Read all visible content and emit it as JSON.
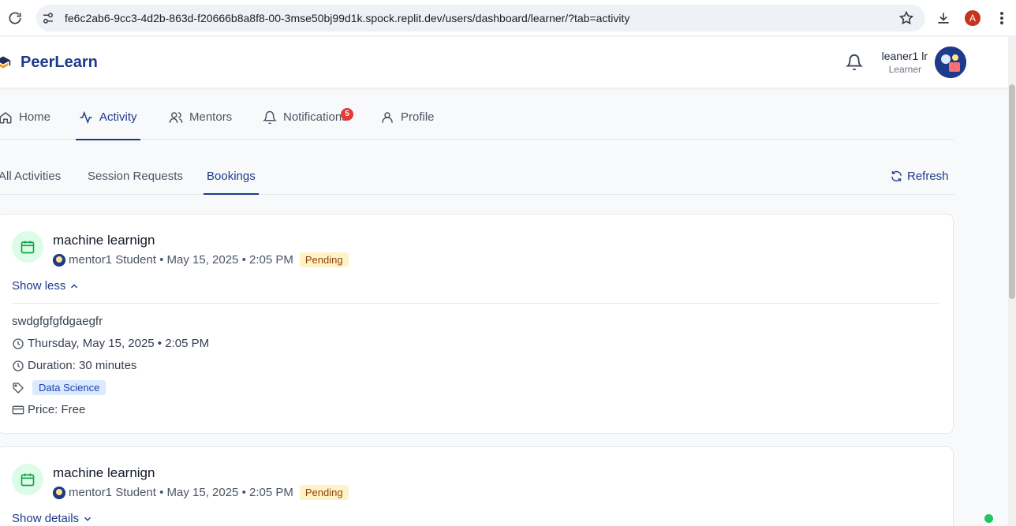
{
  "browser": {
    "url": "fe6c2ab6-9cc3-4d2b-863d-f20666b8a8f8-00-3mse50bj99d1k.spock.replit.dev/users/dashboard/learner/?tab=activity",
    "profile_initial": "A"
  },
  "header": {
    "brand": "PeerLearn",
    "user_name": "leaner1 lr",
    "user_role": "Learner"
  },
  "main_nav": {
    "tabs": [
      {
        "label": "Home",
        "icon": "home-icon"
      },
      {
        "label": "Activity",
        "icon": "activity-icon",
        "active": true
      },
      {
        "label": "Mentors",
        "icon": "users-icon"
      },
      {
        "label": "Notifications",
        "icon": "bell-icon",
        "badge": "5"
      },
      {
        "label": "Profile",
        "icon": "user-icon"
      }
    ]
  },
  "sub_nav": {
    "tabs": [
      {
        "label": "All Activities"
      },
      {
        "label": "Session Requests"
      },
      {
        "label": "Bookings",
        "active": true
      }
    ],
    "refresh_label": "Refresh"
  },
  "bookings": [
    {
      "title": "machine learnign",
      "mentor": "mentor1 Student",
      "date": "May 15, 2025",
      "time": "2:05 PM",
      "status": "Pending",
      "toggle_label": "Show less",
      "expanded": true,
      "description": "swdgfgfgfdgaegfr",
      "full_date": "Thursday, May 15, 2025 • 2:05 PM",
      "duration": "Duration: 30 minutes",
      "tag": "Data Science",
      "price": "Price: Free"
    },
    {
      "title": "machine learnign",
      "mentor": "mentor1 Student",
      "date": "May 15, 2025",
      "time": "2:05 PM",
      "status": "Pending",
      "toggle_label": "Show details",
      "expanded": false
    }
  ],
  "colors": {
    "brand": "#1e3a8a",
    "pending_bg": "#fef3c7",
    "icon_green": "#16a34a",
    "tag_bg": "#dbeafe",
    "online": "#22c55e"
  }
}
